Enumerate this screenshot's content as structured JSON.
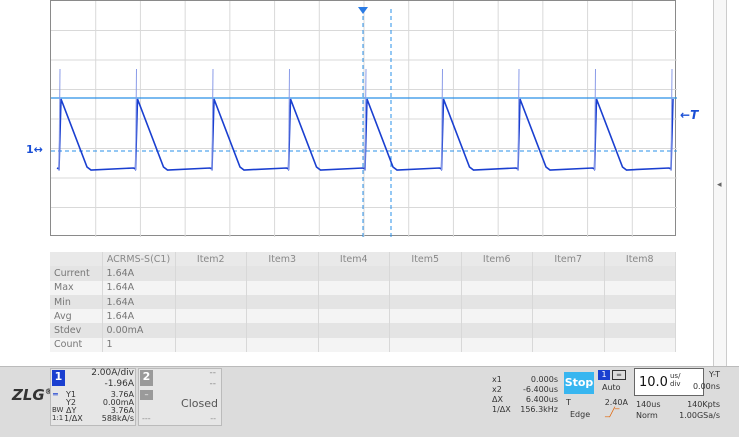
{
  "waveform": {
    "channel_marker": "1",
    "trigger_marker": "T",
    "colors": {
      "trace": "#1a3fd0",
      "cursor": "#2a90e8",
      "grid": "#d9d9d9"
    }
  },
  "table": {
    "headers": [
      "",
      "ACRMS-S(C1)",
      "Item2",
      "Item3",
      "Item4",
      "Item5",
      "Item6",
      "Item7",
      "Item8"
    ],
    "rows": [
      {
        "label": "Current",
        "value": "1.64A"
      },
      {
        "label": "Max",
        "value": "1.64A"
      },
      {
        "label": "Min",
        "value": "1.64A"
      },
      {
        "label": "Avg",
        "value": "1.64A"
      },
      {
        "label": "Stdev",
        "value": "0.00mA"
      },
      {
        "label": "Count",
        "value": "1"
      }
    ]
  },
  "status": {
    "logo": "ZLG",
    "ch1": {
      "num": "1",
      "vdiv": "2.00A/div",
      "offset": "-1.96A",
      "y1_label": "Y1",
      "y1": "3.76A",
      "y2_label": "Y2",
      "y2": "0.00mA",
      "dy_label": "ΔY",
      "dy": "3.76A",
      "rate_label": "1/ΔX",
      "rate": "588kA/s",
      "bw": "BW",
      "coupling": "1:1"
    },
    "ch2": {
      "num": "2",
      "line1": "--",
      "line2": "--",
      "state": "Closed",
      "line3": "--",
      "line4": "---"
    },
    "cursor": {
      "x1_label": "x1",
      "x1": "0.000s",
      "x2_label": "x2",
      "x2": "-6.400us",
      "dx_label": "ΔX",
      "dx": "6.400us",
      "fx_label": "1/ΔX",
      "fx": "156.3kHz"
    },
    "acq": {
      "state": "Stop"
    },
    "trigger": {
      "channel": "1",
      "mode": "Auto",
      "t_label": "T",
      "level": "2.40A",
      "type": "Edge"
    },
    "timebase": {
      "value": "10.0",
      "unit_top": "us/",
      "unit_bottom": "div",
      "mode": "Y-T",
      "delay": "0.00ns",
      "window": "140us",
      "points": "140Kpts",
      "acq_mode": "Norm",
      "sample_rate": "1.00GSa/s"
    }
  },
  "side_handle": "◂"
}
